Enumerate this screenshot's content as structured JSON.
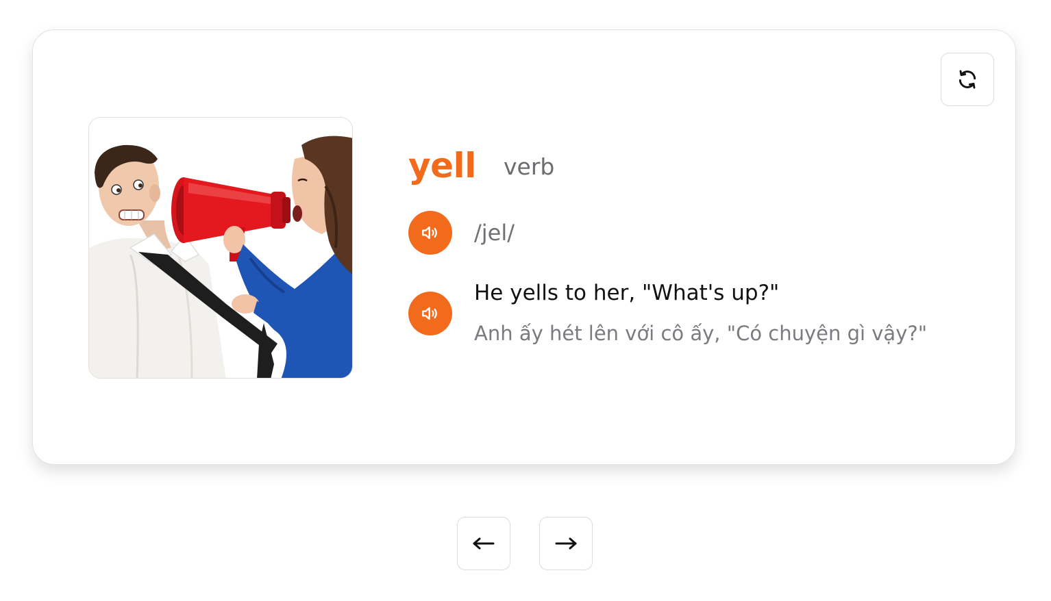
{
  "flashcard": {
    "word": "yell",
    "part_of_speech": "verb",
    "phonetic": "/jel/",
    "example": "He yells to her, \"What's up?\"",
    "translation": "Anh ấy hét lên với cô ấy, \"Có chuyện gì vậy?\"",
    "image_subject": "woman yelling through a red megaphone at a man in a white shirt"
  },
  "icons": {
    "flip": "refresh-icon",
    "word_audio": "speaker-icon",
    "example_audio": "speaker-icon",
    "prev": "arrow-left-icon",
    "next": "arrow-right-icon"
  },
  "colors": {
    "accent": "#f26a1b",
    "muted_text": "#6b6b70",
    "card_border": "#e3e3e3"
  }
}
